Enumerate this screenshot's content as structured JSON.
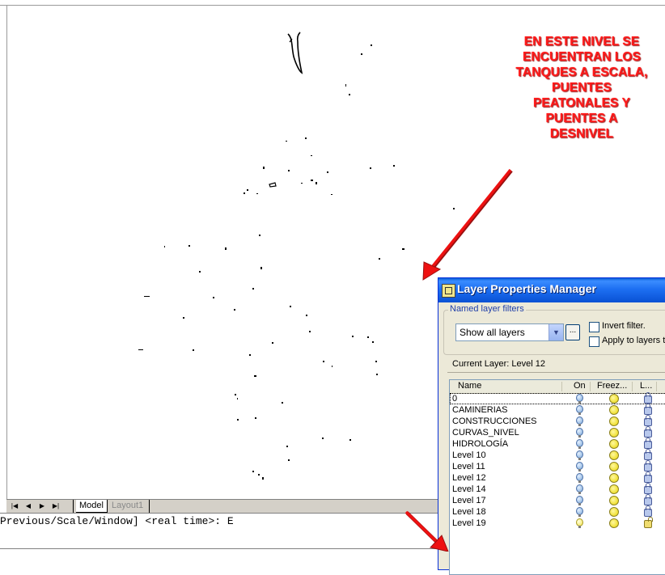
{
  "annotation": {
    "lines": [
      "EN ESTE NIVEL SE",
      "ENCUENTRAN LOS",
      "TANQUES A ESCALA,",
      "PUENTES",
      "PEATONALES Y",
      "PUENTES A",
      "DESNIVEL"
    ],
    "color": "#ff1a1a"
  },
  "layout_tabs": {
    "model_label": "Model",
    "layout_label": "Layout1",
    "nav_icons": [
      "first-tab-icon",
      "prev-tab-icon",
      "next-tab-icon",
      "last-tab-icon"
    ]
  },
  "command_line": {
    "text": "Previous/Scale/Window] <real time>: E"
  },
  "dialog": {
    "title": "Layer Properties Manager",
    "title_bar_color": "#0a5fd8",
    "filters_group_label": "Named layer filters",
    "filter_selected": "Show all layers",
    "more_button_label": "...",
    "invert_filter_label": "Invert filter.",
    "apply_to_layers_label": "Apply to layers to",
    "current_layer_label": "Current Layer:",
    "current_layer_value": "Level 12",
    "columns": {
      "name": "Name",
      "on": "On",
      "freeze": "Freez...",
      "lock": "L..."
    },
    "layers": [
      {
        "name": "0",
        "on_icon": "bulb-icon",
        "freeze_icon": "sun-icon",
        "lock_icon": "lock-icon"
      },
      {
        "name": "CAMINERIAS",
        "on_icon": "bulb-icon",
        "freeze_icon": "sun-icon",
        "lock_icon": "lock-icon"
      },
      {
        "name": "CONSTRUCCIONES",
        "on_icon": "bulb-icon",
        "freeze_icon": "sun-icon",
        "lock_icon": "lock-icon"
      },
      {
        "name": "CURVAS_NIVEL",
        "on_icon": "bulb-icon",
        "freeze_icon": "sun-icon",
        "lock_icon": "lock-icon"
      },
      {
        "name": "HIDROLOGÍA",
        "on_icon": "bulb-icon",
        "freeze_icon": "sun-icon",
        "lock_icon": "lock-icon"
      },
      {
        "name": "Level 10",
        "on_icon": "bulb-icon",
        "freeze_icon": "sun-icon",
        "lock_icon": "lock-icon"
      },
      {
        "name": "Level 11",
        "on_icon": "bulb-icon",
        "freeze_icon": "sun-icon",
        "lock_icon": "lock-icon"
      },
      {
        "name": "Level 12",
        "on_icon": "bulb-icon",
        "freeze_icon": "sun-icon",
        "lock_icon": "lock-icon"
      },
      {
        "name": "Level 14",
        "on_icon": "bulb-icon",
        "freeze_icon": "sun-icon",
        "lock_icon": "lock-icon"
      },
      {
        "name": "Level 17",
        "on_icon": "bulb-icon",
        "freeze_icon": "sun-icon",
        "lock_icon": "lock-icon"
      },
      {
        "name": "Level 18",
        "on_icon": "bulb-icon",
        "freeze_icon": "sun-icon",
        "lock_icon": "lock-icon"
      },
      {
        "name": "Level 19",
        "on_icon": "bulb-icon",
        "freeze_icon": "sun-icon",
        "lock_icon": "lock-icon"
      }
    ]
  }
}
